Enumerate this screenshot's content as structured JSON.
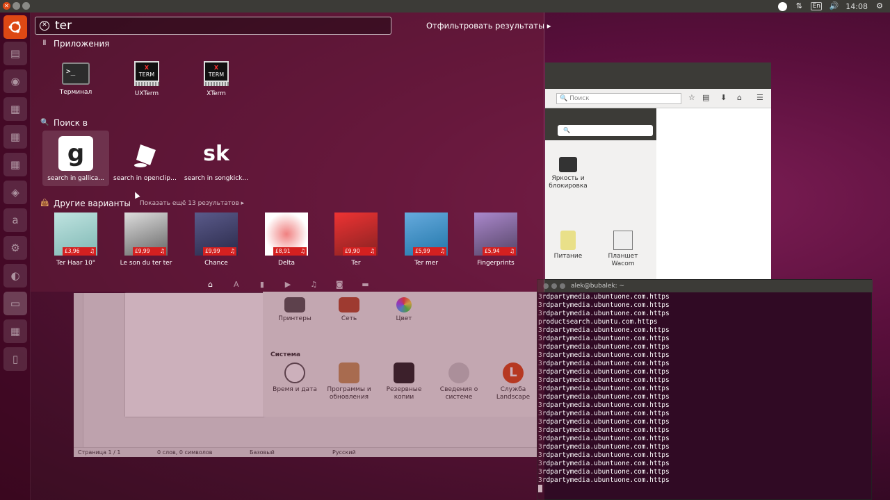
{
  "panel": {
    "clock": "14:08",
    "kbd": "En"
  },
  "terminal": {
    "title": "alek@bubalek: ~",
    "lines": [
      "3rdpartymedia.ubuntuone.com.https",
      "3rdpartymedia.ubuntuone.com.https",
      "3rdpartymedia.ubuntuone.com.https",
      "productsearch.ubuntu.com.https",
      "3rdpartymedia.ubuntuone.com.https",
      "3rdpartymedia.ubuntuone.com.https",
      "3rdpartymedia.ubuntuone.com.https",
      "3rdpartymedia.ubuntuone.com.https",
      "3rdpartymedia.ubuntuone.com.https",
      "3rdpartymedia.ubuntuone.com.https",
      "3rdpartymedia.ubuntuone.com.https",
      "3rdpartymedia.ubuntuone.com.https",
      "3rdpartymedia.ubuntuone.com.https",
      "3rdpartymedia.ubuntuone.com.https",
      "3rdpartymedia.ubuntuone.com.https",
      "3rdpartymedia.ubuntuone.com.https",
      "3rdpartymedia.ubuntuone.com.https",
      "3rdpartymedia.ubuntuone.com.https",
      "3rdpartymedia.ubuntuone.com.https",
      "3rdpartymedia.ubuntuone.com.https",
      "3rdpartymedia.ubuntuone.com.https",
      "3rdpartymedia.ubuntuone.com.https",
      "3rdpartymedia.ubuntuone.com.https"
    ]
  },
  "browser": {
    "search_placeholder": "Поиск",
    "items": [
      {
        "label": "Яркость и блокировка"
      },
      {
        "label": "Питание"
      },
      {
        "label": "Планшет Wacom"
      }
    ]
  },
  "settings": {
    "top_items": [
      {
        "label": "Принтеры"
      },
      {
        "label": "Сеть"
      },
      {
        "label": "Цвет"
      }
    ],
    "section": "Система",
    "items": [
      {
        "label": "Время и дата"
      },
      {
        "label": "Программы и обновления"
      },
      {
        "label": "Резервные копии"
      },
      {
        "label": "Сведения о системе"
      },
      {
        "label": "Служба Landscape"
      }
    ]
  },
  "writer": {
    "status": {
      "page": "Страница 1 / 1",
      "words": "0 слов, 0 символов",
      "style": "Базовый",
      "lang": "Русский"
    }
  },
  "dash": {
    "search": {
      "value": "ter"
    },
    "filter_label": "Отфильтровать результаты",
    "apps": {
      "heading": "Приложения",
      "items": [
        {
          "label": "Терминал",
          "icon": "terminal-icon"
        },
        {
          "label": "UXTerm",
          "icon": "xterm-icon"
        },
        {
          "label": "XTerm",
          "icon": "xterm-icon"
        }
      ]
    },
    "search_in": {
      "heading": "Поиск в",
      "items": [
        {
          "label": "search in gallica...",
          "glyph": "g"
        },
        {
          "label": "search in openclipart...",
          "glyph": ""
        },
        {
          "label": "search in songkick...",
          "glyph": "sk"
        }
      ]
    },
    "other": {
      "heading": "Другие варианты",
      "more": "Показать ещё 13 результатов",
      "items": [
        {
          "label": "Ter Haar 10\"",
          "price": "£3,96"
        },
        {
          "label": "Le son du ter ter",
          "price": "£9,99"
        },
        {
          "label": "Chance",
          "price": "£9,99"
        },
        {
          "label": "Delta",
          "price": "£8,91"
        },
        {
          "label": "Ter",
          "price": "£9,90"
        },
        {
          "label": "Ter mer",
          "price": "£5,99"
        },
        {
          "label": "Fingerprints",
          "price": "£5,94"
        }
      ]
    }
  },
  "colors": {
    "accent": "#dd4814",
    "terminal_bg": "#300a24",
    "price_tag": "#d42020"
  }
}
